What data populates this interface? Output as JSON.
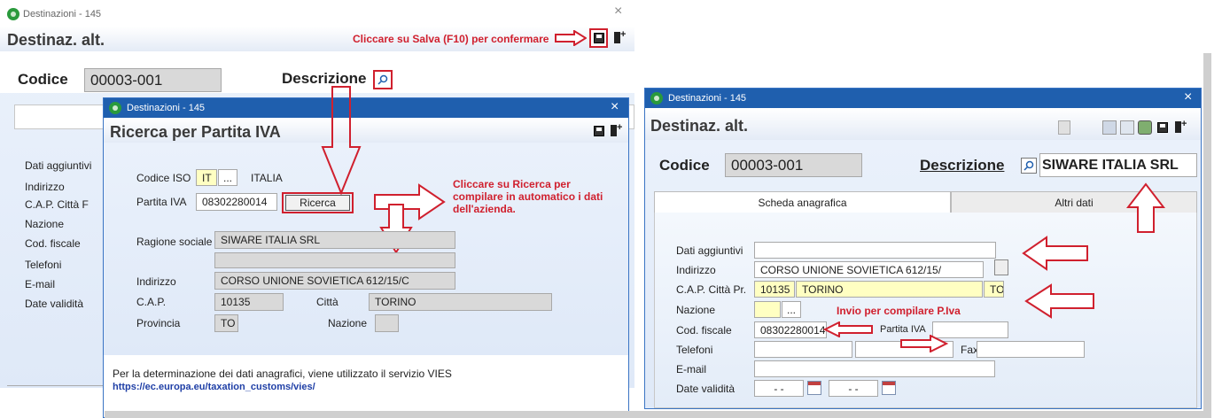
{
  "win1": {
    "title": "Destinazioni - 145",
    "header": "Destinaz. alt.",
    "hint_save": "Cliccare su Salva (F10) per confermare",
    "codice_label": "Codice",
    "codice_value": "00003-001",
    "descrizione_label": "Descrizione",
    "side_labels": [
      "Dati aggiuntivi",
      "Indirizzo",
      "C.A.P.  Città  F",
      "Nazione",
      "Cod. fiscale",
      "Telefoni",
      "E-mail",
      "Date validità"
    ]
  },
  "win2": {
    "title": "Destinazioni - 145",
    "header": "Ricerca per Partita IVA",
    "codice_iso_label": "Codice ISO",
    "codice_iso_value": "IT",
    "codice_iso_btn": "...",
    "paese": "ITALIA",
    "partita_iva_label": "Partita IVA",
    "partita_iva_value": "08302280014",
    "ricerca_btn": "Ricerca",
    "hint_ricerca": "Cliccare su Ricerca per compilare in automatico i dati dell'azienda.",
    "ragione_sociale_label": "Ragione sociale",
    "ragione_sociale_value": "SIWARE ITALIA SRL",
    "ragione_sociale_2": "",
    "indirizzo_label": "Indirizzo",
    "indirizzo_value": "CORSO UNIONE SOVIETICA 612/15/C",
    "cap_label": "C.A.P.",
    "cap_value": "10135",
    "citta_label": "Città",
    "citta_value": "TORINO",
    "provincia_label": "Provincia",
    "provincia_value": "TO",
    "nazione_label": "Nazione",
    "nazione_value": "",
    "footer_text": "Per la determinazione dei dati anagrafici, viene utilizzato il servizio VIES",
    "footer_link": "https://ec.europa.eu/taxation_customs/vies/"
  },
  "win3": {
    "title": "Destinazioni - 145",
    "header": "Destinaz. alt.",
    "codice_label": "Codice",
    "codice_value": "00003-001",
    "descrizione_label": "Descrizione",
    "descrizione_value": "SIWARE ITALIA SRL",
    "tab1": "Scheda anagrafica",
    "tab2": "Altri dati",
    "dati_aggiuntivi_label": "Dati aggiuntivi",
    "dati_aggiuntivi_value": "",
    "indirizzo_label": "Indirizzo",
    "indirizzo_value": "CORSO UNIONE SOVIETICA 612/15/",
    "cap_citta_label": "C.A.P.  Città  Pr.",
    "cap_value": "10135",
    "citta_value": "TORINO",
    "provincia_value": "TO",
    "nazione_label": "Nazione",
    "nazione_value": "",
    "nazione_btn": "...",
    "hint_invio": "Invio per compilare P.Iva",
    "cod_fiscale_label": "Cod. fiscale",
    "cod_fiscale_value": "08302280014",
    "partita_iva_label": "Partita IVA",
    "partita_iva_value": "",
    "telefoni_label": "Telefoni",
    "telefoni_value1": "",
    "telefoni_value2": "",
    "fax_label": "Fax",
    "fax_value": "",
    "email_label": "E-mail",
    "email_value": "",
    "date_validita_label": "Date validità",
    "date_from": "- -",
    "date_to": "- -"
  },
  "colors": {
    "accent_red": "#d0202e",
    "title_blue": "#1f5fae",
    "field_yellow": "#ffffc2"
  }
}
